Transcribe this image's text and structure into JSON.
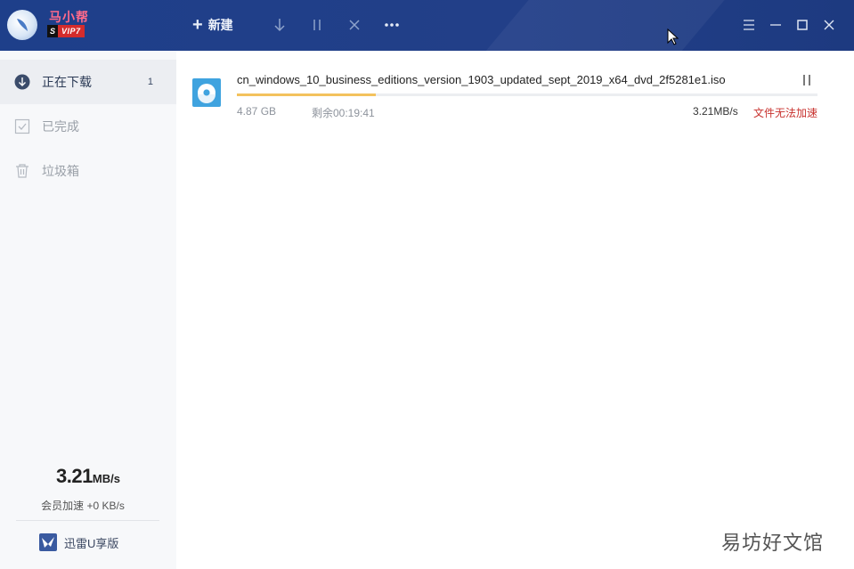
{
  "header": {
    "username": "马小帮",
    "vip_s": "S",
    "vip_level": "VIP7",
    "new_label": "新建",
    "new_plus": "+"
  },
  "sidebar": {
    "items": [
      {
        "label": "正在下载",
        "count": "1",
        "icon": "download-circle-icon"
      },
      {
        "label": "已完成",
        "icon": "checkbox-icon"
      },
      {
        "label": "垃圾箱",
        "icon": "trash-icon"
      }
    ],
    "speed_value": "3.21",
    "speed_unit": "MB/s",
    "accel_text": "会员加速 +0 KB/s",
    "ufont_label": "迅雷U享版"
  },
  "task": {
    "filename": "cn_windows_10_business_editions_version_1903_updated_sept_2019_x64_dvd_2f5281e1.iso",
    "size": "4.87 GB",
    "remaining": "剩余00:19:41",
    "speed": "3.21MB/s",
    "accel_note": "文件无法加速",
    "progress": 0.24
  },
  "watermark": "易坊好文馆",
  "colors": {
    "titlebar": "#1e3f8a",
    "progress": "#f3c25d",
    "warning": "#c8322e",
    "vip_badge": "#d42c2c",
    "username": "#ff6b8b"
  }
}
